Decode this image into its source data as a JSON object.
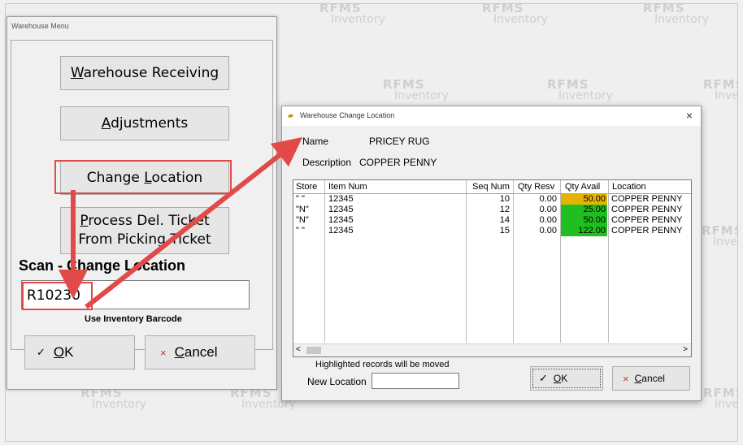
{
  "watermark": {
    "brand": "RFMS",
    "product": "Inventory"
  },
  "menu": {
    "title": "Warehouse Menu",
    "buttons": {
      "receiving": {
        "pre": "",
        "key": "W",
        "post": "arehouse Receiving"
      },
      "adjustments": {
        "pre": "",
        "key": "A",
        "post": "djustments"
      },
      "change_location": {
        "pre": "Change ",
        "key": "L",
        "post": "ocation"
      },
      "process_line1": {
        "pre": "",
        "key": "P",
        "post": "rocess Del. Ticket"
      },
      "process_line2": "From Picking Ticket"
    },
    "scan_label": "Scan - Change Location",
    "scan_value": "R10230",
    "scan_hint": "Use Inventory Barcode",
    "ok": {
      "icon": "✓",
      "key": "O",
      "post": "K"
    },
    "cancel": {
      "icon": "×",
      "key": "C",
      "post": "ancel"
    }
  },
  "dialog": {
    "title": "Warehouse Change Location",
    "close_glyph": "×",
    "name_label": "Name",
    "name_value": "PRICEY RUG",
    "desc_label": "Description",
    "desc_value": "COPPER PENNY",
    "columns": [
      "Store",
      "Item Num",
      "Seq Num",
      "Qty Resv",
      "Qty Avail",
      "Location"
    ],
    "rows": [
      {
        "store": "\" \"",
        "item": "12345",
        "seq": "10",
        "resv": "0.00",
        "avail": "50.00",
        "location": "COPPER PENNY",
        "avail_color": "#e6b400"
      },
      {
        "store": "\"N\"",
        "item": "12345",
        "seq": "12",
        "resv": "0.00",
        "avail": "25.00",
        "location": "COPPER PENNY",
        "avail_color": "#1fbf1f"
      },
      {
        "store": "\"N\"",
        "item": "12345",
        "seq": "14",
        "resv": "0.00",
        "avail": "50.00",
        "location": "COPPER PENNY",
        "avail_color": "#1fbf1f"
      },
      {
        "store": "\" \"",
        "item": "12345",
        "seq": "15",
        "resv": "0.00",
        "avail": "122.00",
        "location": "COPPER PENNY",
        "avail_color": "#1fbf1f"
      }
    ],
    "scroll_left": "<",
    "scroll_right": ">",
    "note": "Highlighted records will be moved",
    "new_location_label": "New Location",
    "new_location_value": "",
    "ok": {
      "icon": "✓",
      "key": "O",
      "post": "K"
    },
    "cancel": {
      "icon": "×",
      "key": "C",
      "post": "ancel"
    }
  },
  "colors": {
    "annotation": "#e24a4a",
    "yellow_avail": "#e6b400",
    "green_avail": "#1fbf1f"
  }
}
